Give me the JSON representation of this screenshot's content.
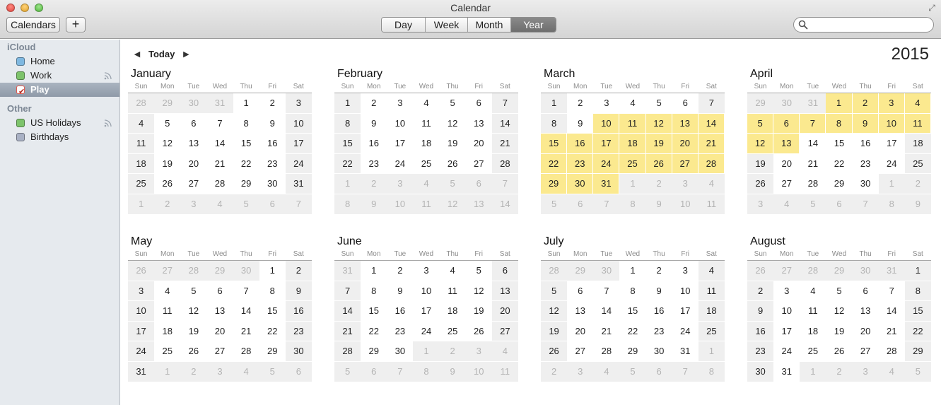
{
  "window": {
    "title": "Calendar"
  },
  "toolbar": {
    "calendars_label": "Calendars",
    "add_label": "+",
    "views": [
      "Day",
      "Week",
      "Month",
      "Year"
    ],
    "active_view": "Year",
    "search_placeholder": ""
  },
  "sidebar": {
    "groups": [
      {
        "label": "iCloud",
        "items": [
          {
            "label": "Home",
            "color": "#7fb8e0",
            "checked": false,
            "shared": false
          },
          {
            "label": "Work",
            "color": "#7dc36b",
            "checked": false,
            "shared": true
          },
          {
            "label": "Play",
            "color": "#e15a4f",
            "checked": true,
            "shared": false,
            "selected": true
          }
        ]
      },
      {
        "label": "Other",
        "items": [
          {
            "label": "US Holidays",
            "color": "#7dc36b",
            "checked": false,
            "shared": true
          },
          {
            "label": "Birthdays",
            "color": "#a9b1c4",
            "checked": false,
            "shared": false
          }
        ]
      }
    ]
  },
  "nav": {
    "today_label": "Today"
  },
  "year": "2015",
  "weekday_labels": [
    "Sun",
    "Mon",
    "Tue",
    "Wed",
    "Thu",
    "Fri",
    "Sat"
  ],
  "highlight_color": "#fbe98f",
  "months": [
    {
      "name": "January",
      "year": 2015,
      "index": 0
    },
    {
      "name": "February",
      "year": 2015,
      "index": 1
    },
    {
      "name": "March",
      "year": 2015,
      "index": 2,
      "highlight": [
        [
          10,
          31
        ]
      ]
    },
    {
      "name": "April",
      "year": 2015,
      "index": 3,
      "highlight": [
        [
          1,
          13
        ]
      ]
    },
    {
      "name": "May",
      "year": 2015,
      "index": 4
    },
    {
      "name": "June",
      "year": 2015,
      "index": 5
    },
    {
      "name": "July",
      "year": 2015,
      "index": 6
    },
    {
      "name": "August",
      "year": 2015,
      "index": 7
    }
  ]
}
